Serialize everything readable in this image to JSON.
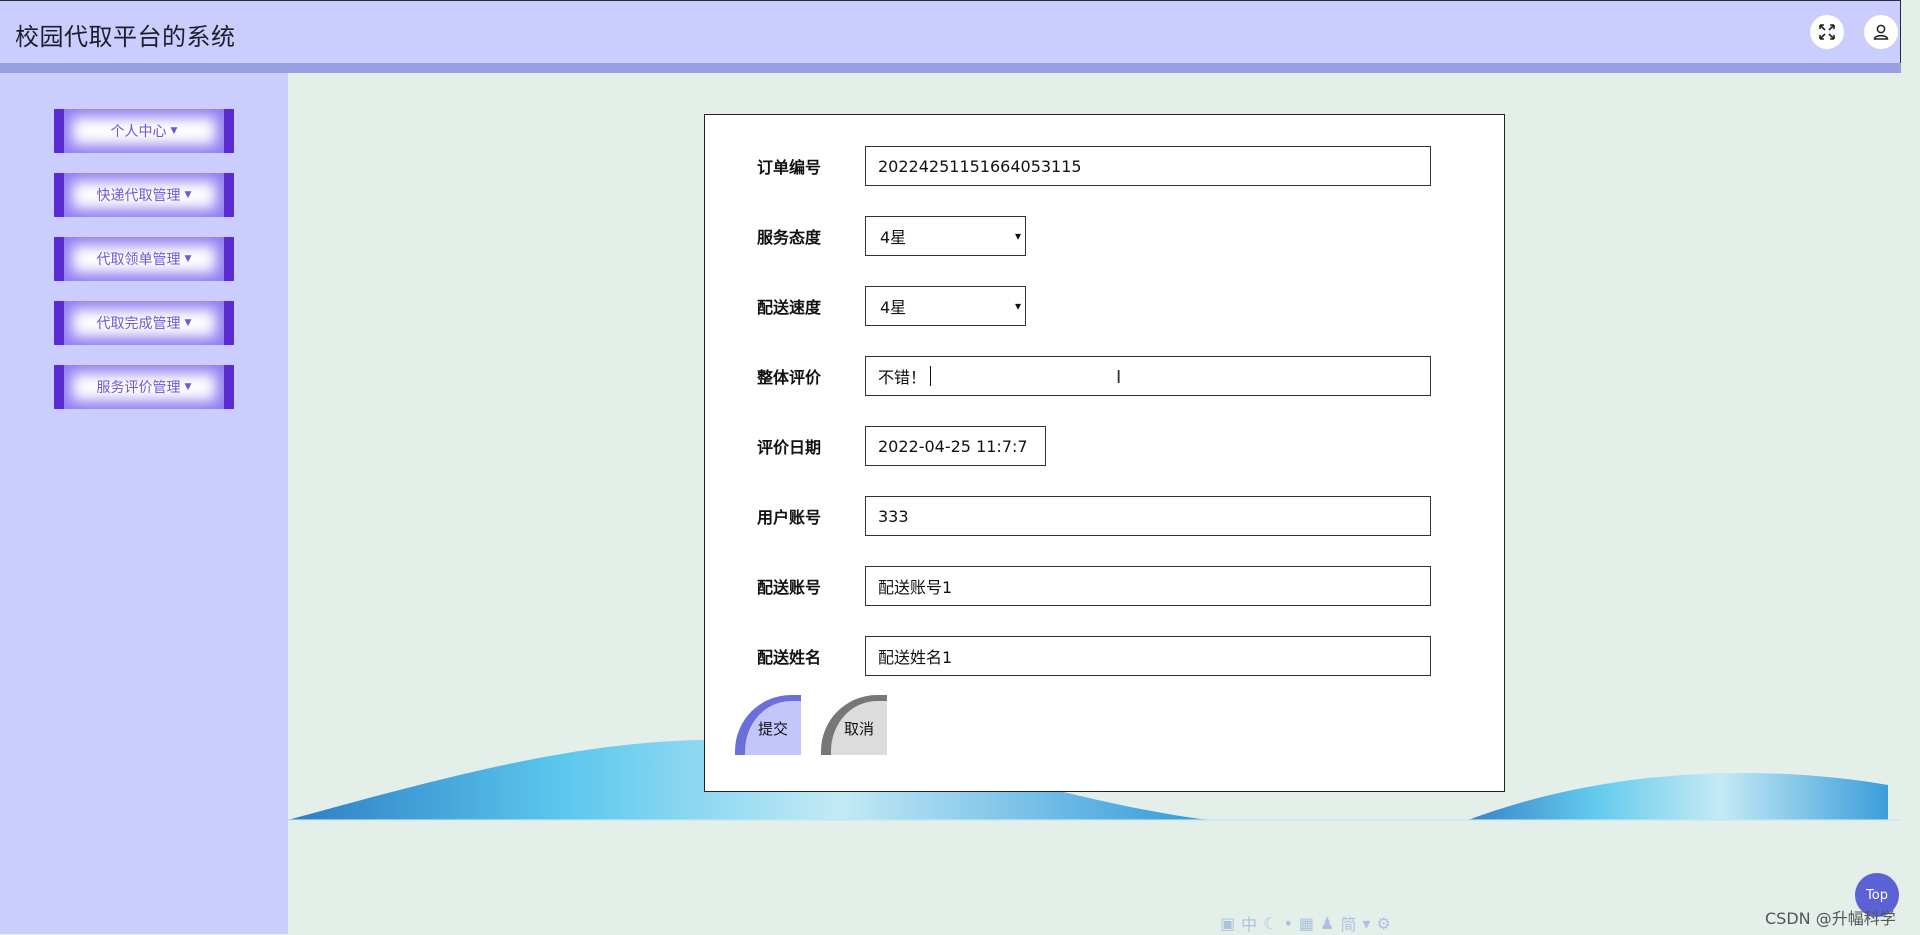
{
  "header": {
    "title": "校园代取平台的系统",
    "fullscreen_icon": "expand-icon",
    "user_icon": "user-icon"
  },
  "sidebar": {
    "items": [
      {
        "label": "个人中心"
      },
      {
        "label": "快递代取管理"
      },
      {
        "label": "代取领单管理"
      },
      {
        "label": "代取完成管理"
      },
      {
        "label": "服务评价管理"
      }
    ]
  },
  "form": {
    "order_no": {
      "label": "订单编号",
      "value": "20224251151664053115"
    },
    "service_attitude": {
      "label": "服务态度",
      "value": "4星"
    },
    "delivery_speed": {
      "label": "配送速度",
      "value": "4星"
    },
    "overall_review": {
      "label": "整体评价",
      "value": "不错！"
    },
    "review_date": {
      "label": "评价日期",
      "value": "2022-04-25 11:7:7"
    },
    "user_account": {
      "label": "用户账号",
      "value": "333"
    },
    "delivery_account": {
      "label": "配送账号",
      "value": "配送账号1"
    },
    "delivery_name": {
      "label": "配送姓名",
      "value": "配送姓名1"
    },
    "submit_label": "提交",
    "cancel_label": "取消"
  },
  "footer": {
    "top_label": "Top",
    "watermark": "CSDN @升幅科学"
  },
  "colors": {
    "header_bg": "#cacdfd",
    "accent": "#5a2bd0",
    "page_bg": "#e3efe8"
  }
}
